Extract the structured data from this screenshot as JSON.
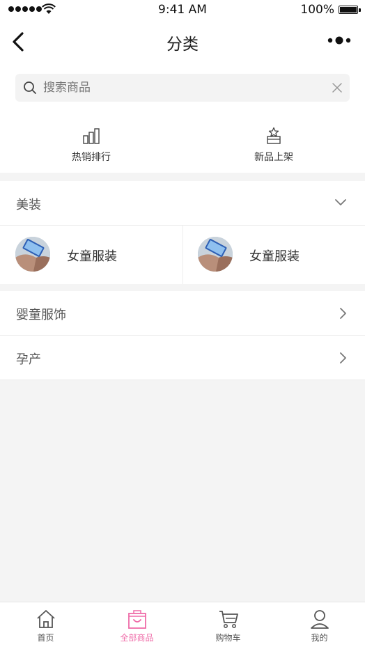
{
  "status_bar": {
    "time": "9:41 AM",
    "battery": "100%"
  },
  "nav": {
    "title": "分类"
  },
  "search": {
    "placeholder": "搜索商品"
  },
  "quick_links": [
    {
      "label": "热销排行",
      "icon": "bar-chart-icon"
    },
    {
      "label": "新品上架",
      "icon": "new-box-icon"
    }
  ],
  "categories": {
    "expanded": {
      "label": "美装",
      "children": [
        {
          "name": "女童服装",
          "image": "phone-photo"
        },
        {
          "name": "女童服装",
          "image": "phone-photo"
        }
      ]
    },
    "collapsed": [
      {
        "label": "婴童服饰"
      },
      {
        "label": "孕产"
      }
    ]
  },
  "tabbar": {
    "active_color": "#ef6ba8",
    "items": [
      {
        "label": "首页",
        "icon": "home-icon"
      },
      {
        "label": "全部商品",
        "icon": "shopping-bag-icon",
        "active": true
      },
      {
        "label": "购物车",
        "icon": "cart-icon"
      },
      {
        "label": "我的",
        "icon": "user-icon"
      }
    ]
  }
}
